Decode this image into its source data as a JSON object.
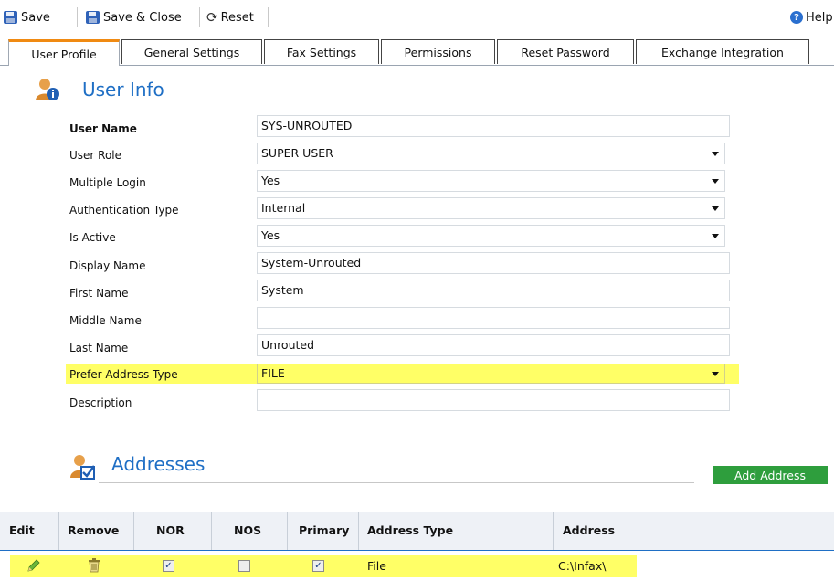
{
  "toolbar": {
    "save_label": "Save",
    "save_close_label": "Save & Close",
    "reset_label": "Reset",
    "help_label": "Help"
  },
  "tabs": [
    {
      "label": "User Profile",
      "active": true
    },
    {
      "label": "General Settings"
    },
    {
      "label": "Fax Settings"
    },
    {
      "label": "Permissions"
    },
    {
      "label": "Reset Password"
    },
    {
      "label": "Exchange Integration"
    }
  ],
  "user_info": {
    "title": "User Info",
    "fields": {
      "user_name": {
        "label": "User Name",
        "value": "SYS-UNROUTED"
      },
      "user_role": {
        "label": "User Role",
        "value": "SUPER USER"
      },
      "multiple_login": {
        "label": "Multiple Login",
        "value": "Yes"
      },
      "authentication_type": {
        "label": "Authentication Type",
        "value": "Internal"
      },
      "is_active": {
        "label": "Is Active",
        "value": "Yes"
      },
      "display_name": {
        "label": "Display Name",
        "value": "System-Unrouted"
      },
      "first_name": {
        "label": "First Name",
        "value": "System"
      },
      "middle_name": {
        "label": "Middle Name",
        "value": ""
      },
      "last_name": {
        "label": "Last Name",
        "value": "Unrouted"
      },
      "prefer_address_type": {
        "label": "Prefer Address Type",
        "value": "FILE"
      },
      "description": {
        "label": "Description",
        "value": ""
      }
    }
  },
  "addresses": {
    "title": "Addresses",
    "add_button_label": "Add Address",
    "columns": [
      "Edit",
      "Remove",
      "NOR",
      "NOS",
      "Primary",
      "Address Type",
      "Address"
    ],
    "rows": [
      {
        "nor": true,
        "nos": false,
        "primary": true,
        "address_type": "File",
        "address": "C:\\Infax\\"
      }
    ]
  },
  "colors": {
    "accent_blue": "#1f6fc5",
    "highlight_yellow": "#ffff66",
    "add_button_green": "#2e9e3d",
    "active_tab_orange": "#f08a12"
  }
}
